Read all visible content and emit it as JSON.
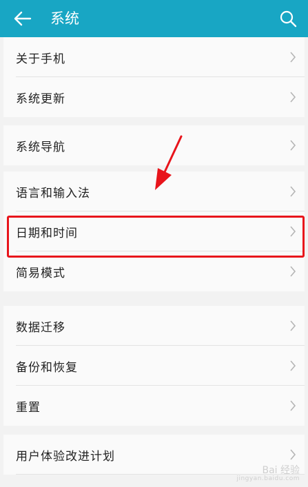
{
  "header": {
    "title": "系统",
    "back_icon": "arrow-left-icon",
    "search_icon": "search-icon",
    "color": "#18a6c4"
  },
  "groups": [
    {
      "items": [
        {
          "label": "关于手机"
        },
        {
          "label": "系统更新"
        }
      ]
    },
    {
      "items": [
        {
          "label": "系统导航"
        }
      ]
    },
    {
      "items": [
        {
          "label": "语言和输入法"
        },
        {
          "label": "日期和时间"
        },
        {
          "label": "简易模式"
        }
      ]
    },
    {
      "items": [
        {
          "label": "数据迁移"
        },
        {
          "label": "备份和恢复"
        },
        {
          "label": "重置"
        }
      ]
    },
    {
      "items": [
        {
          "label": "用户体验改进计划"
        }
      ]
    }
  ],
  "annotation": {
    "highlight_color": "#e8141b",
    "highlighted_item": "日期和时间"
  },
  "watermark": {
    "brand": "Bai 经验",
    "url": "jingyan.baidu.com"
  }
}
